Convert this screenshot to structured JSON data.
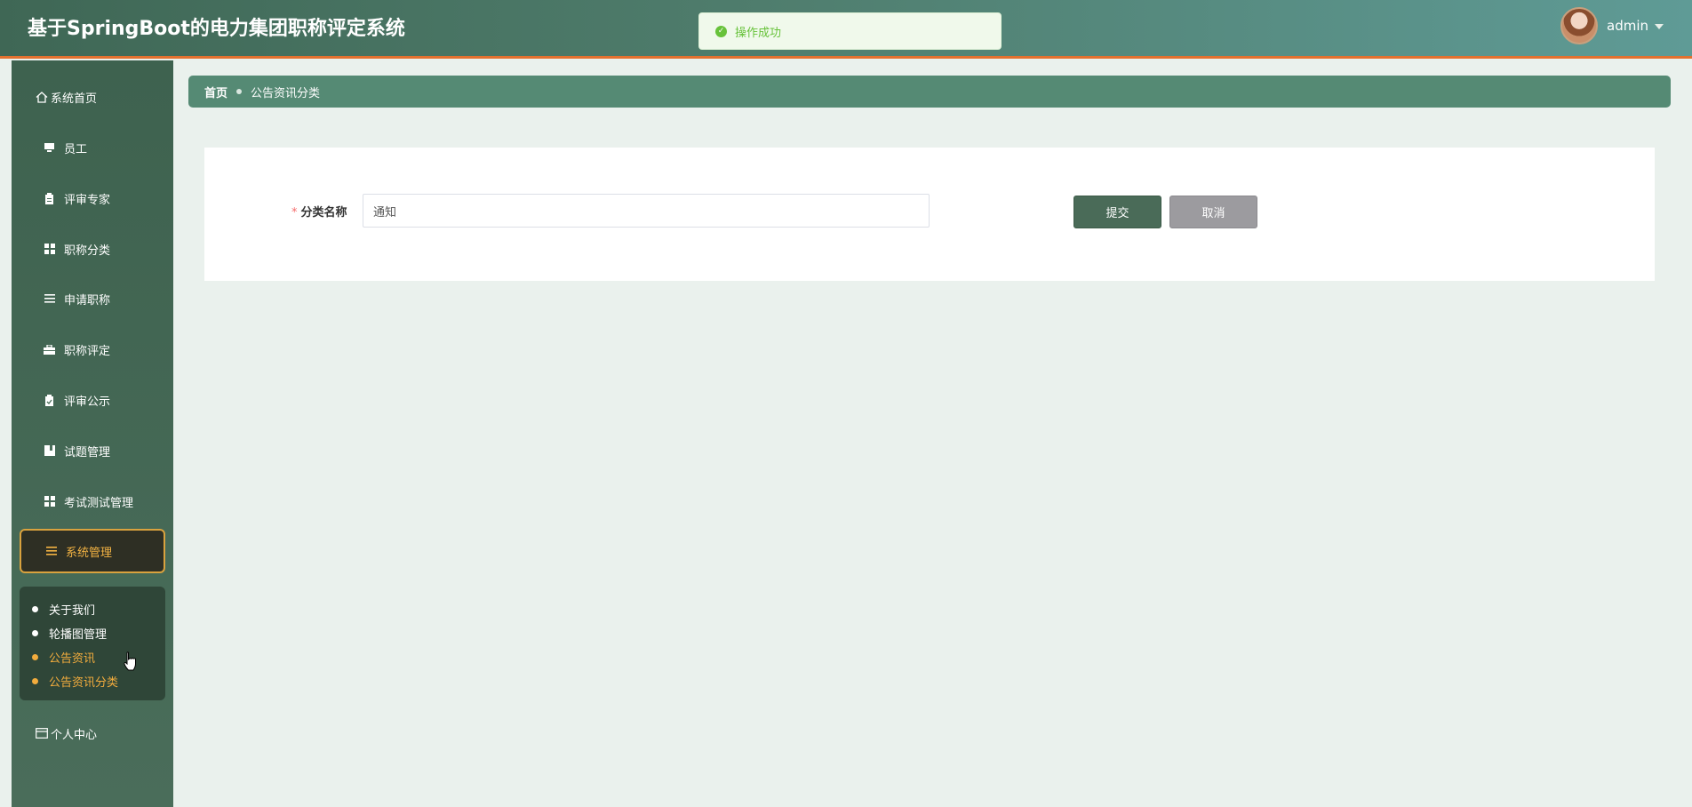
{
  "header": {
    "title": "基于SpringBoot的电力集团职称评定系统",
    "user_name": "admin"
  },
  "toast": {
    "message": "操作成功",
    "icon": "check-circle-icon",
    "color": "#67c23a"
  },
  "sidebar": {
    "items": [
      {
        "label": "系统首页",
        "icon": "home-icon"
      },
      {
        "label": "员工",
        "icon": "monitor-icon"
      },
      {
        "label": "评审专家",
        "icon": "clipboard-icon"
      },
      {
        "label": "职称分类",
        "icon": "grid-icon"
      },
      {
        "label": "申请职称",
        "icon": "list-icon"
      },
      {
        "label": "职称评定",
        "icon": "briefcase-icon"
      },
      {
        "label": "评审公示",
        "icon": "clipboard-check-icon"
      },
      {
        "label": "试题管理",
        "icon": "book-icon"
      },
      {
        "label": "考试测试管理",
        "icon": "grid-icon"
      },
      {
        "label": "系统管理",
        "icon": "list-icon",
        "active": true
      },
      {
        "label": "个人中心",
        "icon": "id-card-icon"
      }
    ],
    "submenu": [
      {
        "label": "关于我们"
      },
      {
        "label": "轮播图管理"
      },
      {
        "label": "公告资讯"
      },
      {
        "label": "公告资讯分类"
      }
    ],
    "active_color": "#f3b343"
  },
  "breadcrumb": {
    "home": "首页",
    "current": "公告资讯分类"
  },
  "form": {
    "field_label": "分类名称",
    "required_mark": "*",
    "field_value": "通知",
    "submit_label": "提交",
    "cancel_label": "取消"
  }
}
